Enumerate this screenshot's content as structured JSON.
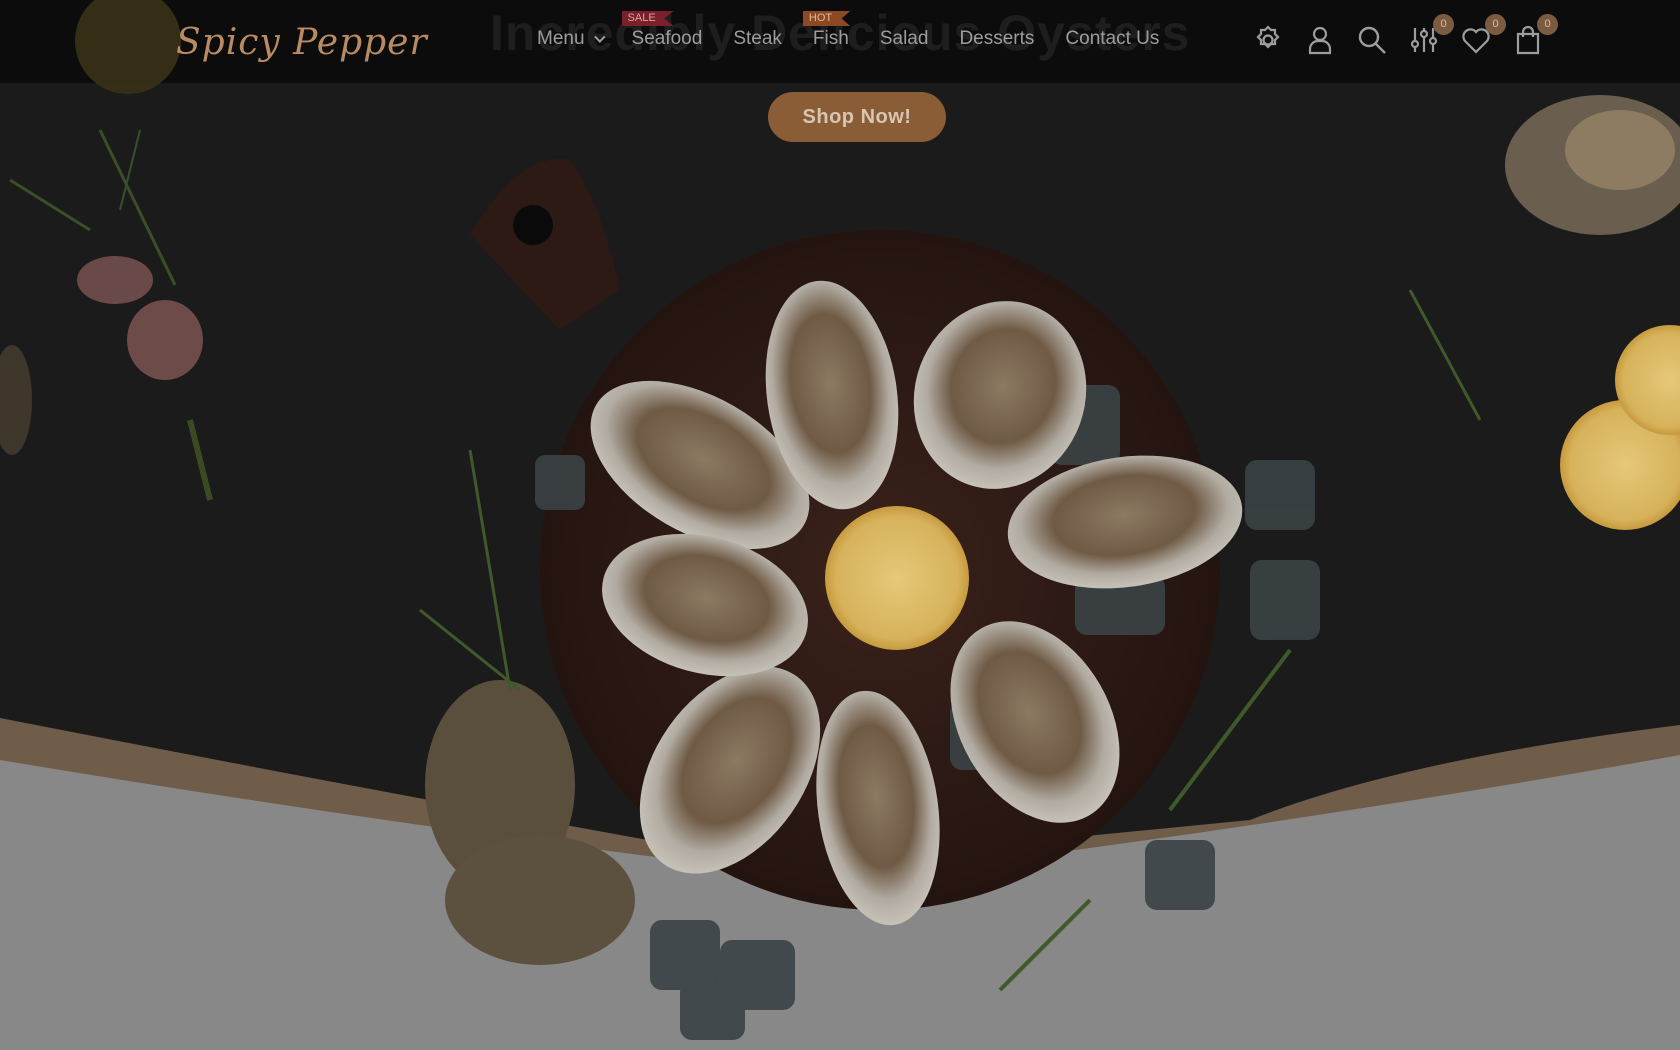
{
  "brand": {
    "name": "Spicy Pepper"
  },
  "hero": {
    "ghost_title": "Incredibly Delicious Oysters",
    "cta": "Shop Now!"
  },
  "nav": {
    "items": [
      {
        "label": "Menu",
        "has_dropdown": true
      },
      {
        "label": "Seafood",
        "tag": "SALE"
      },
      {
        "label": "Steak"
      },
      {
        "label": "Fish",
        "tag": "HOT"
      },
      {
        "label": "Salad"
      },
      {
        "label": "Desserts"
      },
      {
        "label": "Contact Us"
      }
    ]
  },
  "header_icons": [
    {
      "name": "settings-icon"
    },
    {
      "name": "user-icon"
    },
    {
      "name": "search-icon"
    },
    {
      "name": "compare-icon",
      "count": "0"
    },
    {
      "name": "heart-icon",
      "count": "0"
    },
    {
      "name": "shopping-bag-icon",
      "count": "0"
    }
  ],
  "colors": {
    "accent": "#8b5d36",
    "header_bg": "#0c0c0c",
    "nav_text": "#9d9d9d"
  }
}
